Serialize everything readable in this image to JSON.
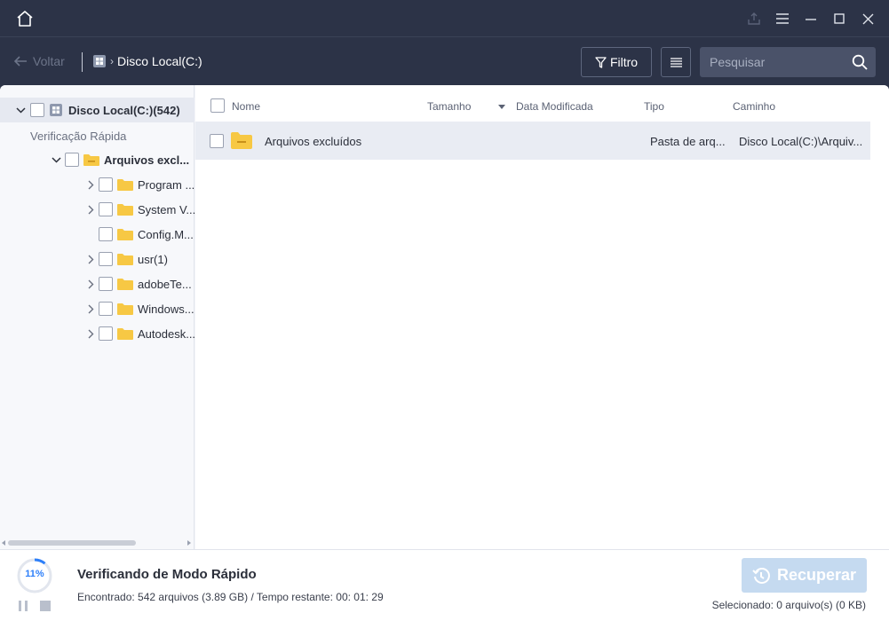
{
  "toolbar": {
    "back_label": "Voltar",
    "breadcrumb": "Disco Local(C:)",
    "filter_label": "Filtro",
    "search_placeholder": "Pesquisar"
  },
  "sidebar": {
    "root_label": "Disco Local(C:)(542)",
    "section_label": "Verificação Rápida",
    "group_label": "Arquivos excl...",
    "children": [
      {
        "label": "Program ...",
        "expandable": true
      },
      {
        "label": "System V...",
        "expandable": true
      },
      {
        "label": "Config.M...",
        "expandable": false
      },
      {
        "label": "usr(1)",
        "expandable": true
      },
      {
        "label": "adobeTe...",
        "expandable": true
      },
      {
        "label": "Windows...",
        "expandable": true
      },
      {
        "label": "Autodesk...",
        "expandable": true
      }
    ]
  },
  "table": {
    "headers": {
      "name": "Nome",
      "size": "Tamanho",
      "modified": "Data Modificada",
      "type": "Tipo",
      "path": "Caminho"
    },
    "rows": [
      {
        "name": "Arquivos excluídos",
        "size": "",
        "modified": "",
        "type": "Pasta de arq...",
        "path": "Disco Local(C:)\\Arquiv..."
      }
    ]
  },
  "status": {
    "progress_percent": 11,
    "progress_label": "11%",
    "title": "Verificando de Modo Rápido",
    "found_text": "Encontrado: 542 arquivos (3.89 GB) / Tempo restante: 00: 01: 29",
    "selected_text": "Selecionado: 0 arquivo(s) (0 KB)",
    "recover_label": "Recuperar"
  },
  "colors": {
    "chrome": "#2c3347",
    "accent": "#2d7ff9",
    "folder": "#f7c844",
    "recover_disabled": "#c5daf0"
  },
  "icons": [
    "home-icon",
    "share-icon",
    "menu-icon",
    "minimize-icon",
    "maximize-icon",
    "close-icon",
    "back-arrow-icon",
    "drive-icon",
    "filter-icon",
    "list-view-icon",
    "search-icon",
    "folder-icon",
    "chevron-down-icon",
    "chevron-right-icon",
    "pause-icon",
    "stop-icon",
    "recover-icon"
  ]
}
